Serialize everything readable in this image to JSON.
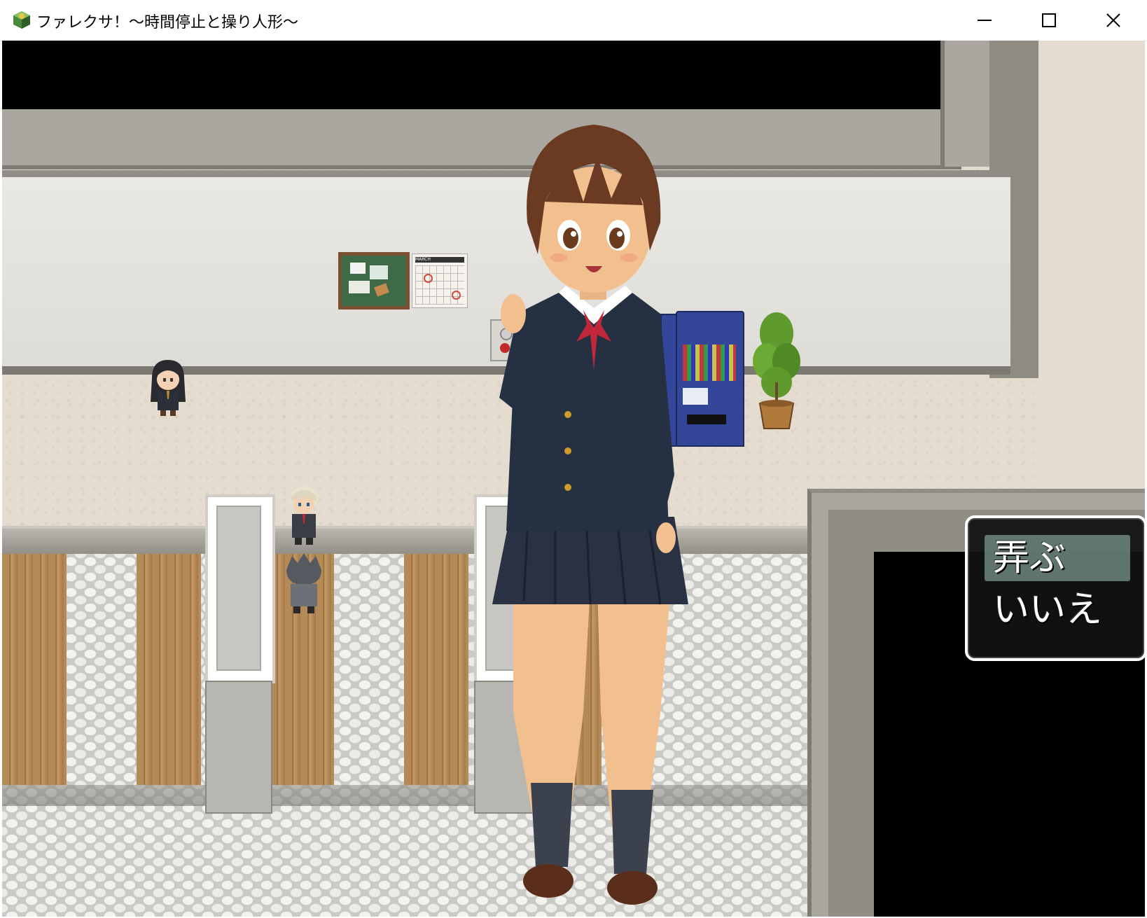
{
  "window": {
    "title": "ファレクサ！～時間停止と操り人形～",
    "icon": "game-app-icon",
    "controls": {
      "minimize_icon": "minimize-icon",
      "maximize_icon": "maximize-icon",
      "close_icon": "close-icon"
    }
  },
  "choice_menu": {
    "options": [
      {
        "label": "弄ぶ",
        "selected": true
      },
      {
        "label": "いいえ",
        "selected": false
      }
    ]
  },
  "wall_items": {
    "calendar_month": "MARCH"
  },
  "colors": {
    "blazer": "#263043",
    "ribbon": "#c0283a",
    "hair": "#6b3a22",
    "skin": "#f1c08e",
    "vending_machine": "#34469a",
    "selection_highlight": "#7a968c"
  }
}
